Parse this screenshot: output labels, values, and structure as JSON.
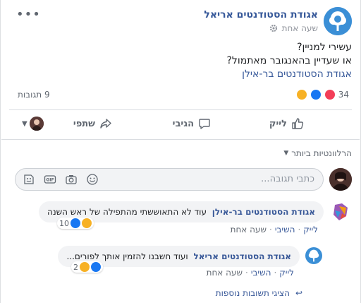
{
  "post": {
    "page_name": "אגודת הסטודנטים אריאל",
    "time": "שעה אחת",
    "text_lines": [
      "עשירי למניין?",
      "או שעדיין בהאנגובר מאתמול?"
    ],
    "tag": "אגודת הסטודנטים בר-אילן",
    "reactions_count": "34",
    "shares": "9 תגובות",
    "reaction_icons": [
      "haha-icon",
      "like-icon",
      "love-icon"
    ]
  },
  "actions": {
    "like": "לייק",
    "comment": "הגיבי",
    "share": "שתפי"
  },
  "comments_section": {
    "relevance": "הרלוונטיות ביותר",
    "composer_placeholder": "כתבי תגובה..."
  },
  "comments": [
    {
      "author": "אגודת הסטודנטים בר-אילן",
      "text": "עוד לא התאוששתי מהתפילה של ראש השנה",
      "react_count": "10",
      "like": "לייק",
      "reply": "השיבי",
      "time": "שעה אחת"
    },
    {
      "author": "אגודת הסטודנטים אריאל",
      "text": "ועוד חשבנו להזמין אותך לפורים...",
      "react_count": "2",
      "like": "לייק",
      "reply": "השיבי",
      "time": "שעה אחת"
    }
  ],
  "more_replies": "הציגי תשובות נוספות",
  "colors": {
    "link": "#365899",
    "like_blue": "#1877f2",
    "haha_yellow": "#f7b125",
    "love_red": "#f33e58"
  }
}
